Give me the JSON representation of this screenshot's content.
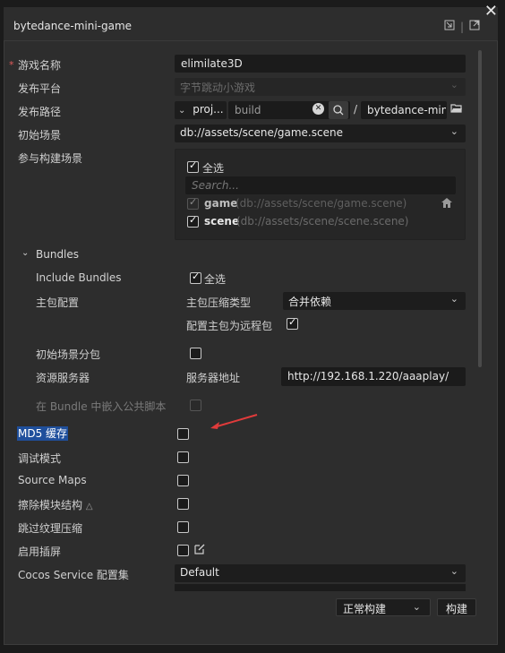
{
  "window": {
    "title": "bytedance-mini-game"
  },
  "form": {
    "game_name_label": "游戏名称",
    "game_name_value": "elimilate3D",
    "platform_label": "发布平台",
    "platform_value": "字节跳动小游戏",
    "path_label": "发布路径",
    "path_prefix": "proj...",
    "path_value": "build",
    "path_sep": "/",
    "path_suffix": "bytedance-mini-g",
    "start_scene_label": "初始场景",
    "start_scene_value": "db://assets/scene/game.scene",
    "build_scenes_label": "参与构建场景",
    "select_all": "全选",
    "search_placeholder": "Search...",
    "scenes": [
      {
        "name": "game",
        "path": "(db://assets/scene/game.scene)",
        "checked": true,
        "disabled": true
      },
      {
        "name": "scene",
        "path": "(db://assets/scene/scene.scene)",
        "checked": true,
        "disabled": false
      }
    ]
  },
  "bundles": {
    "section_label": "Bundles",
    "include_label": "Include Bundles",
    "include_value": "全选",
    "main_config_label": "主包配置",
    "compression_label": "主包压缩类型",
    "compression_value": "合并依赖",
    "remote_label": "配置主包为远程包",
    "subpackage_label": "初始场景分包",
    "server_label": "资源服务器",
    "server_addr_label": "服务器地址",
    "server_addr_value": "http://192.168.1.220/aaaplay/",
    "embed_label": "在 Bundle 中嵌入公共脚本"
  },
  "options": {
    "md5": "MD5 缓存",
    "debug": "调试模式",
    "source_maps": "Source Maps",
    "erase_modules": "擦除模块结构",
    "skip_texture": "跳过纹理压缩",
    "splash": "启用插屏",
    "cocos_service_label": "Cocos Service 配置集",
    "cocos_service_value": "Default"
  },
  "footer": {
    "build_mode": "正常构建",
    "build_button": "构建"
  },
  "colors": {
    "panel": "#2d2d2d",
    "field": "#1b1b1b",
    "highlight": "#1f4f9c",
    "arrow": "#e03b3b",
    "required": "#e05a5a"
  }
}
